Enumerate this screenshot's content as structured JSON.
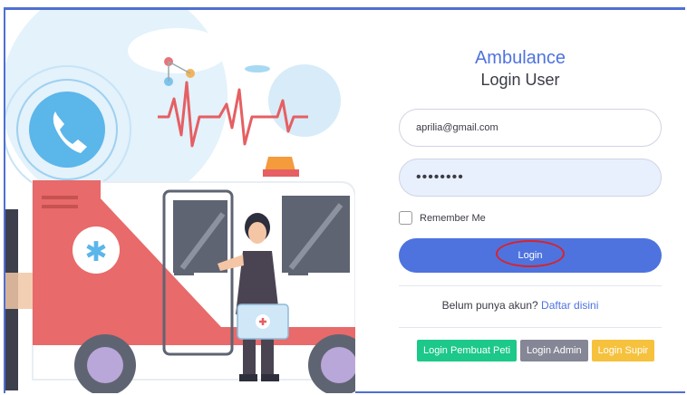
{
  "app": {
    "title": "Ambulance",
    "subtitle": "Login User"
  },
  "form": {
    "email_value": "aprilia@gmail.com",
    "password_mask": "••••••••",
    "remember_label": "Remember Me",
    "login_label": "Login"
  },
  "register": {
    "prompt": "Belum punya akun?",
    "link_label": "Daftar disini"
  },
  "roles": [
    {
      "label": "Login Pembuat Peti"
    },
    {
      "label": "Login Admin"
    },
    {
      "label": "Login Supir"
    }
  ],
  "colors": {
    "primary": "#4e73df",
    "success": "#1cc88a",
    "secondary": "#858796",
    "warning": "#f6c23e",
    "highlight_circle": "#d8232a"
  },
  "icons": {
    "illustration": "ambulance-nurse-illustration"
  }
}
